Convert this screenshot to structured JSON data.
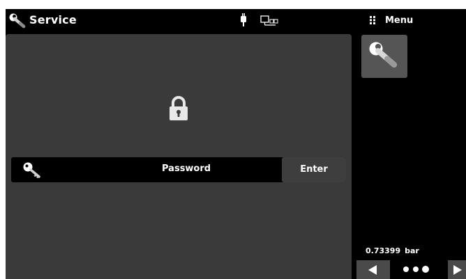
{
  "header": {
    "title": "Service",
    "menu_label": "Menu"
  },
  "icons": {
    "title_icon": "wrench-icon",
    "status_power": "plug-icon",
    "status_network": "network-icon",
    "menu": "grip-icon",
    "lock": "lock-icon",
    "password": "key-icon",
    "tile": "wrench-icon",
    "prev": "arrow-left-icon",
    "next": "arrow-right-icon",
    "pager": "page-dots-icon"
  },
  "password_bar": {
    "label": "Password",
    "enter_label": "Enter"
  },
  "reading": {
    "value": "0.73399",
    "unit": "bar"
  },
  "colors": {
    "background": "#000000",
    "panel": "#3a3a3a",
    "tile": "#555555",
    "text": "#ffffff"
  }
}
